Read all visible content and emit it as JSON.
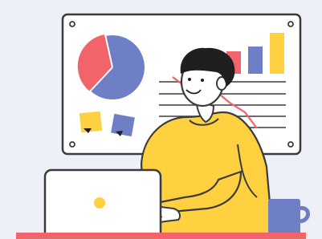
{
  "illustration": {
    "subject": "person-working-at-laptop-in-front-of-dashboard-board",
    "icons": [
      "pie-chart-icon",
      "bar-chart-icon",
      "line-chart-icon",
      "sticky-note-icon",
      "laptop-icon",
      "mug-icon"
    ]
  },
  "colors": {
    "background": "#edf0f6",
    "board": "#ffffff",
    "outline": "#3b3b3b",
    "pie_red": "#f0646a",
    "pie_blue": "#6e7fc6",
    "bar_red": "#f0646a",
    "bar_blue": "#6e7fc6",
    "bar_yellow": "#ffd03f",
    "note_yellow": "#ffd03f",
    "note_blue": "#6e7fc6",
    "shirt": "#ffd03f",
    "skin": "#ffffff",
    "hair": "#1f1f1f",
    "laptop": "#ffffff",
    "laptop_dot": "#ffd03f",
    "mug": "#6e7fc6",
    "desk": "#f0646a"
  }
}
